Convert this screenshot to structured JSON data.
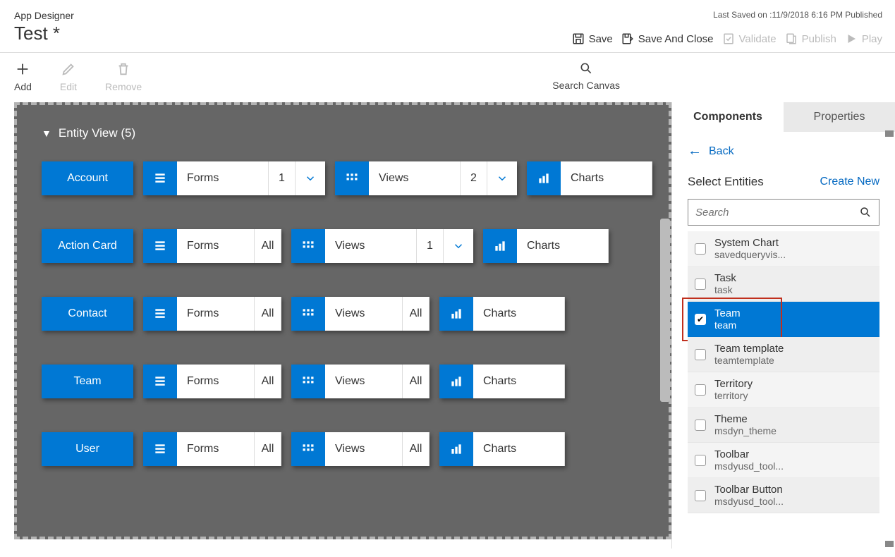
{
  "header": {
    "app_name": "App Designer",
    "app_title": "Test *",
    "last_saved": "Last Saved on :11/9/2018 6:16 PM Published",
    "actions": {
      "save": "Save",
      "save_close": "Save And Close",
      "validate": "Validate",
      "publish": "Publish",
      "play": "Play"
    }
  },
  "toolbar": {
    "add": "Add",
    "edit": "Edit",
    "remove": "Remove",
    "search_canvas": "Search Canvas"
  },
  "canvas": {
    "section_title": "Entity View (5)",
    "rows": [
      {
        "entity": "Account",
        "forms": {
          "label": "Forms",
          "count": "1",
          "chev": true
        },
        "views": {
          "label": "Views",
          "count": "2",
          "chev": true
        },
        "charts": {
          "label": "Charts"
        }
      },
      {
        "entity": "Action Card",
        "forms": {
          "label": "Forms",
          "count": "All"
        },
        "views": {
          "label": "Views",
          "count": "1",
          "chev": true
        },
        "charts": {
          "label": "Charts"
        }
      },
      {
        "entity": "Contact",
        "forms": {
          "label": "Forms",
          "count": "All"
        },
        "views": {
          "label": "Views",
          "count": "All"
        },
        "charts": {
          "label": "Charts"
        }
      },
      {
        "entity": "Team",
        "forms": {
          "label": "Forms",
          "count": "All"
        },
        "views": {
          "label": "Views",
          "count": "All"
        },
        "charts": {
          "label": "Charts"
        }
      },
      {
        "entity": "User",
        "forms": {
          "label": "Forms",
          "count": "All"
        },
        "views": {
          "label": "Views",
          "count": "All"
        },
        "charts": {
          "label": "Charts"
        }
      }
    ]
  },
  "right": {
    "tabs": {
      "components": "Components",
      "properties": "Properties"
    },
    "back": "Back",
    "select_label": "Select Entities",
    "create_new": "Create New",
    "search_placeholder": "Search",
    "entities": [
      {
        "title": "System Chart",
        "sub": "savedqueryvis...",
        "checked": false
      },
      {
        "title": "Task",
        "sub": "task",
        "checked": false
      },
      {
        "title": "Team",
        "sub": "team",
        "checked": true,
        "highlighted": true
      },
      {
        "title": "Team template",
        "sub": "teamtemplate",
        "checked": false
      },
      {
        "title": "Territory",
        "sub": "territory",
        "checked": false
      },
      {
        "title": "Theme",
        "sub": "msdyn_theme",
        "checked": false
      },
      {
        "title": "Toolbar",
        "sub": "msdyusd_tool...",
        "checked": false
      },
      {
        "title": "Toolbar Button",
        "sub": "msdyusd_tool...",
        "checked": false
      }
    ]
  }
}
